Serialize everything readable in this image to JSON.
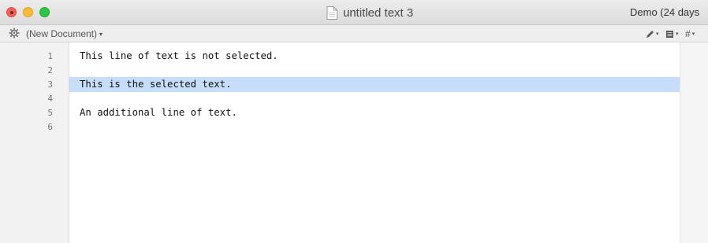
{
  "window": {
    "title": "untitled text 3",
    "demo_status": "Demo (24 days"
  },
  "toolbar": {
    "document_menu_label": "(New Document)",
    "caret": "▾",
    "tools": [
      {
        "icon": "pencil-icon",
        "symbol": "✎"
      },
      {
        "icon": "document-icon",
        "symbol": "▤"
      },
      {
        "icon": "hash-icon",
        "symbol": "#"
      }
    ]
  },
  "editor": {
    "line_numbers": [
      "1",
      "2",
      "3",
      "4",
      "5",
      "6"
    ],
    "lines": [
      "This line of text is not selected.",
      "",
      "This is the selected text.",
      "",
      "An additional line of text.",
      ""
    ],
    "selected_line": 3
  },
  "colors": {
    "selection": "#c7defa",
    "close": "#fc5f57",
    "minimize": "#fdbc2e",
    "zoom": "#28c840"
  }
}
